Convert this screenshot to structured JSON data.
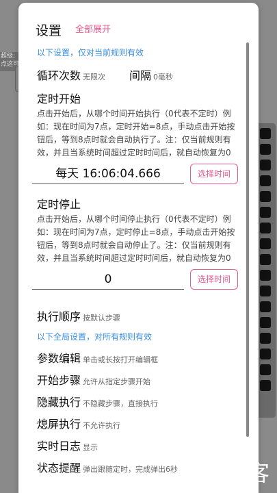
{
  "background": {
    "left_tag": "超级;点这可",
    "watermark": "大玩客"
  },
  "dialog": {
    "title": "设置",
    "expand_all": "全部展开",
    "local_hint": "以下设置，仅对当前规则有效",
    "loop": {
      "label": "循环次数",
      "value": "无限次"
    },
    "interval": {
      "label": "间隔",
      "value": "0毫秒"
    },
    "timer_start": {
      "title": "定时开始",
      "desc": "点击开始后，从哪个时间开始执行（0代表不定时）例如：现在时间为7点，定时开始=8点，手动点击开始按钮后，等到8点时就会自动执行了。注：仅当前规则有效，并且当系统时间超过定时时间后，就自动恢复为0",
      "value": "每天 16:06:04.666",
      "button": "选择时间"
    },
    "timer_stop": {
      "title": "定时停止",
      "desc": "点击开始后，从哪个时间停止执行（0代表不定时）例如：现在时间为7点，定时停止=8点，手动点击开始按钮后，等到8点时就会自动停止了。注：仅当前规则有效，并且当系统时间超过定时时间后，就自动恢复为0",
      "value": "0",
      "button": "选择时间"
    },
    "order": {
      "label": "执行顺序",
      "value": "按默认步骤"
    },
    "global_hint": "以下全局设置，对所有规则有效",
    "items": [
      {
        "label": "参数编辑",
        "value": "单击或长按打开编辑框"
      },
      {
        "label": "开始步骤",
        "value": "允许从指定步骤开始"
      },
      {
        "label": "隐藏执行",
        "value": "不隐藏步骤，直接执行"
      },
      {
        "label": "熄屏执行",
        "value": "不允许执行"
      },
      {
        "label": "实时日志",
        "value": "显示"
      },
      {
        "label": "状态提醒",
        "value": "弹出跟随定时，完成弹出6秒"
      }
    ]
  },
  "colors": {
    "accent": "#e85a8e",
    "hint": "#3a8ee6"
  }
}
